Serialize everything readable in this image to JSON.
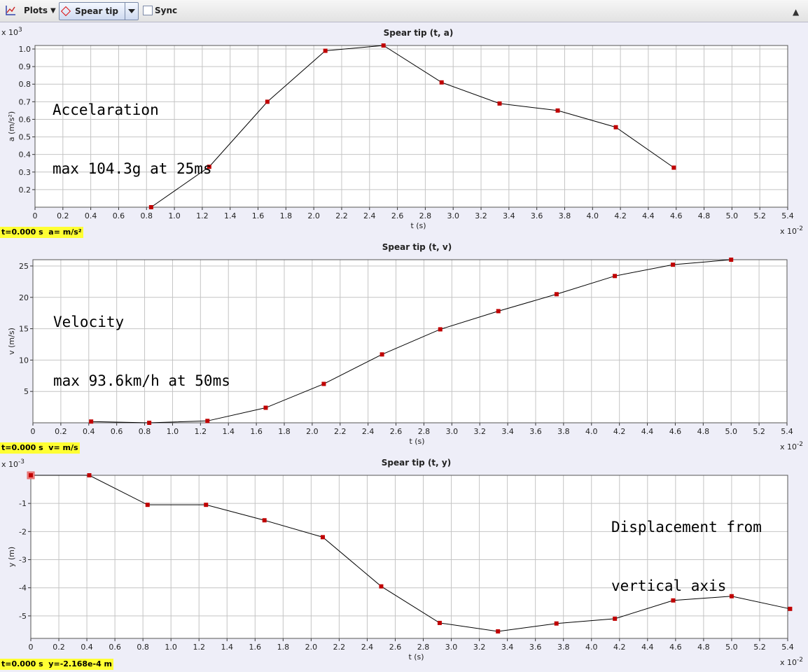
{
  "toolbar": {
    "plots_label": "Plots",
    "track_label": "Spear tip",
    "sync_label": "Sync"
  },
  "plots": [
    {
      "title": "Spear tip (t, a)",
      "ylabel": "a (m/s²)",
      "xlabel": "t (s)",
      "y_exponent": "x 10^3",
      "x_exponent": "x 10^-2",
      "readout": "t=0.000 s  a= m/s²",
      "annotation_line1": "Accelaration",
      "annotation_line2": "max 104.3g at 25ms"
    },
    {
      "title": "Spear tip (t, v)",
      "ylabel": "v (m/s)",
      "xlabel": "t (s)",
      "y_exponent": "",
      "x_exponent": "x 10^-2",
      "readout": "t=0.000 s  v= m/s",
      "annotation_line1": "Velocity",
      "annotation_line2": "max 93.6km/h at 50ms"
    },
    {
      "title": "Spear tip (t, y)",
      "ylabel": "y (m)",
      "xlabel": "t (s)",
      "y_exponent": "x 10^-3",
      "x_exponent": "x 10^-2",
      "readout": "t=0.000 s  y=-2.168e-4 m",
      "annotation_line1": "Displacement from",
      "annotation_line2": "vertical axis"
    }
  ],
  "chart_data": [
    {
      "type": "line",
      "title": "Spear tip (t, a)",
      "xlabel": "t (s)",
      "ylabel": "a (m/s²)",
      "xlim": [
        0,
        5.4
      ],
      "ylim": [
        0.1,
        1.02
      ],
      "xticks": [
        "0",
        "0.2",
        "0.4",
        "0.6",
        "0.8",
        "1.0",
        "1.2",
        "1.4",
        "1.6",
        "1.8",
        "2.0",
        "2.2",
        "2.4",
        "2.6",
        "2.8",
        "3.0",
        "3.2",
        "3.4",
        "3.6",
        "3.8",
        "4.0",
        "4.2",
        "4.4",
        "4.6",
        "4.8",
        "5.0",
        "5.2",
        "5.4"
      ],
      "yticks": [
        "0.2",
        "0.3",
        "0.4",
        "0.5",
        "0.6",
        "0.7",
        "0.8",
        "0.9",
        "1.0"
      ],
      "x": [
        0.833,
        1.25,
        1.667,
        2.083,
        2.5,
        2.917,
        3.333,
        3.75,
        4.167,
        4.583
      ],
      "y": [
        0.1,
        0.33,
        0.7,
        0.99,
        1.02,
        0.81,
        0.69,
        0.65,
        0.555,
        0.325
      ],
      "grid": true,
      "marker_color": "#c00000",
      "line_color": "#000000"
    },
    {
      "type": "line",
      "title": "Spear tip (t, v)",
      "xlabel": "t (s)",
      "ylabel": "v (m/s)",
      "xlim": [
        0,
        5.4
      ],
      "ylim": [
        0,
        26
      ],
      "xticks": [
        "0",
        "0.2",
        "0.4",
        "0.6",
        "0.8",
        "1.0",
        "1.2",
        "1.4",
        "1.6",
        "1.8",
        "2.0",
        "2.2",
        "2.4",
        "2.6",
        "2.8",
        "3.0",
        "3.2",
        "3.4",
        "3.6",
        "3.8",
        "4.0",
        "4.2",
        "4.4",
        "4.6",
        "4.8",
        "5.0",
        "5.2",
        "5.4"
      ],
      "yticks": [
        "5",
        "10",
        "15",
        "20",
        "25"
      ],
      "x": [
        0.417,
        0.833,
        1.25,
        1.667,
        2.083,
        2.5,
        2.917,
        3.333,
        3.75,
        4.167,
        4.583,
        5.0
      ],
      "y": [
        0.2,
        0.0,
        0.3,
        2.4,
        6.2,
        10.9,
        14.9,
        17.8,
        20.5,
        23.4,
        25.2,
        26.0
      ],
      "grid": true,
      "marker_color": "#c00000",
      "line_color": "#000000"
    },
    {
      "type": "line",
      "title": "Spear tip (t, y)",
      "xlabel": "t (s)",
      "ylabel": "y (m)",
      "xlim": [
        0,
        5.4
      ],
      "ylim": [
        -5.8,
        0
      ],
      "xticks": [
        "0",
        "0.2",
        "0.4",
        "0.6",
        "0.8",
        "1.0",
        "1.2",
        "1.4",
        "1.6",
        "1.8",
        "2.0",
        "2.2",
        "2.4",
        "2.6",
        "2.8",
        "3.0",
        "3.2",
        "3.4",
        "3.6",
        "3.8",
        "4.0",
        "4.2",
        "4.4",
        "4.6",
        "4.8",
        "5.0",
        "5.2",
        "5.4"
      ],
      "yticks": [
        "-1",
        "-2",
        "-3",
        "-4",
        "-5"
      ],
      "x": [
        0,
        0.417,
        0.833,
        1.25,
        1.667,
        2.083,
        2.5,
        2.917,
        3.333,
        3.75,
        4.167,
        4.583,
        5.0,
        5.417
      ],
      "y": [
        0,
        0,
        -1.05,
        -1.05,
        -1.6,
        -2.2,
        -3.95,
        -5.25,
        -5.55,
        -5.27,
        -5.1,
        -4.45,
        -4.3,
        -4.75
      ],
      "grid": true,
      "marker_color": "#c00000",
      "line_color": "#000000",
      "selected_point_index": 0
    }
  ]
}
